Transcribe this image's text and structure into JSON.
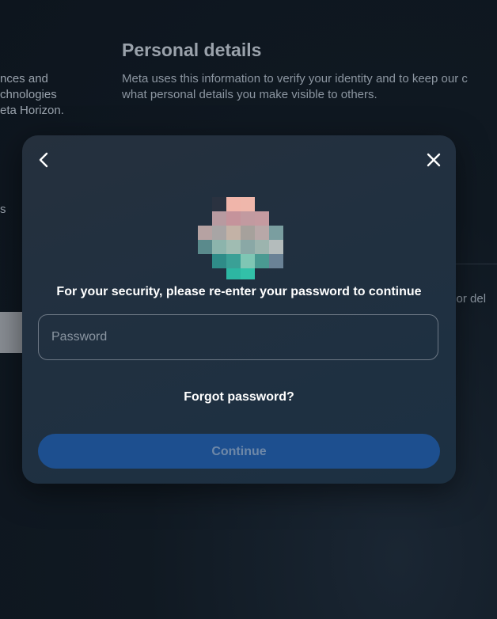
{
  "background": {
    "left_lines": [
      "nces and",
      "chnologies",
      "eta Horizon."
    ],
    "left_fragment": "s",
    "section_title": "Personal details",
    "section_desc_lines": [
      "Meta uses this information to verify your identity and to keep our c",
      "what personal details you make visible to others."
    ],
    "right_fragment": "e or del"
  },
  "modal": {
    "back_icon": "chevron-left-icon",
    "close_icon": "close-icon",
    "avatar_icon": "pixelated-avatar",
    "security_message": "For your security, please re-enter your password to continue",
    "password": {
      "placeholder": "Password",
      "value": ""
    },
    "forgot_password_label": "Forgot password?",
    "continue_label": "Continue"
  },
  "colors": {
    "modal_bg": "#223040",
    "continue_button": "#1d4f8f",
    "continue_text": "#6e88a8",
    "field_border": "#6d7885"
  }
}
